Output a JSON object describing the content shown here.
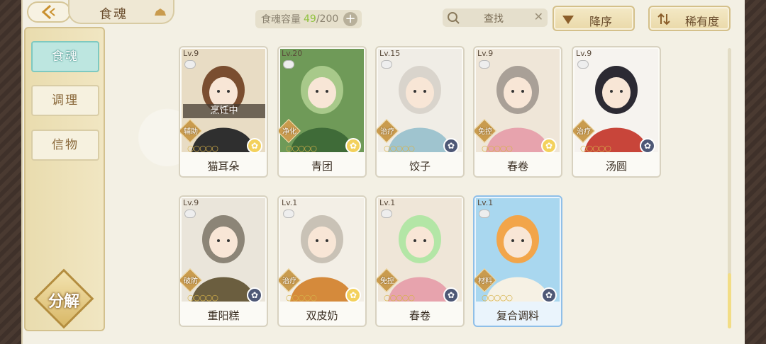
{
  "header": {
    "title": "食魂",
    "capacity_label": "食魂容量",
    "capacity_current": "49",
    "capacity_max": "/200",
    "add_symbol": "+",
    "search_placeholder": "查找",
    "search_clear": "✕",
    "sort_order_label": "降序",
    "sort_key_label": "稀有度"
  },
  "nav": {
    "items": [
      {
        "label": "食魂",
        "active": true
      },
      {
        "label": "调理",
        "active": false
      },
      {
        "label": "信物",
        "active": false
      }
    ],
    "decompose_label": "分解"
  },
  "colors": {
    "accent_teal": "#bde6e0",
    "gold": "#d6b24a",
    "capacity_green": "#8fc13c"
  },
  "cards": [
    {
      "level": "Lv.9",
      "role": "辅助",
      "stars": "○○○○○",
      "name": "猫耳朵",
      "status": "烹饪中",
      "badge": "gold",
      "palette": [
        "#e8dcc4",
        "#7a4e30",
        "#2f2f2f"
      ]
    },
    {
      "level": "Lv.20",
      "role": "净化",
      "stars": "○○○○○",
      "name": "青团",
      "status": "",
      "badge": "gold",
      "palette": [
        "#6f9a58",
        "#a8c98a",
        "#3f6b38"
      ]
    },
    {
      "level": "Lv.15",
      "role": "治疗",
      "stars": "○○○○○",
      "name": "饺子",
      "status": "",
      "badge": "dark",
      "palette": [
        "#f0ede6",
        "#d9d4cc",
        "#9fc4cf"
      ]
    },
    {
      "level": "Lv.9",
      "role": "免控",
      "stars": "○○○○○",
      "name": "春卷",
      "status": "",
      "badge": "gold",
      "palette": [
        "#efe6d8",
        "#a9a097",
        "#e7a3ad"
      ]
    },
    {
      "level": "Lv.9",
      "role": "治疗",
      "stars": "○○○○○",
      "name": "汤圆",
      "status": "",
      "badge": "dark",
      "palette": [
        "#f6f3ef",
        "#2c2a33",
        "#c8453a"
      ]
    },
    {
      "level": "Lv.9",
      "role": "破防",
      "stars": "○○○○○",
      "name": "重阳糕",
      "status": "",
      "badge": "dark",
      "palette": [
        "#eae5da",
        "#8c8577",
        "#6b5e3f"
      ]
    },
    {
      "level": "Lv.1",
      "role": "治疗",
      "stars": "○○○○○",
      "name": "双皮奶",
      "status": "",
      "badge": "gold",
      "palette": [
        "#f3efe6",
        "#c9c2b6",
        "#d58a3b"
      ]
    },
    {
      "level": "Lv.1",
      "role": "免控",
      "stars": "○○○○○",
      "name": "春卷",
      "status": "",
      "badge": "dark",
      "palette": [
        "#efe6d8",
        "#b3e6a6",
        "#e7a3ad"
      ]
    },
    {
      "level": "Lv.1",
      "role": "材料",
      "stars": "○○○○○",
      "name": "复合调料",
      "status": "",
      "badge": "dark",
      "palette": [
        "#a9d7ef",
        "#f2a54a",
        "#f6f1e4"
      ]
    }
  ]
}
